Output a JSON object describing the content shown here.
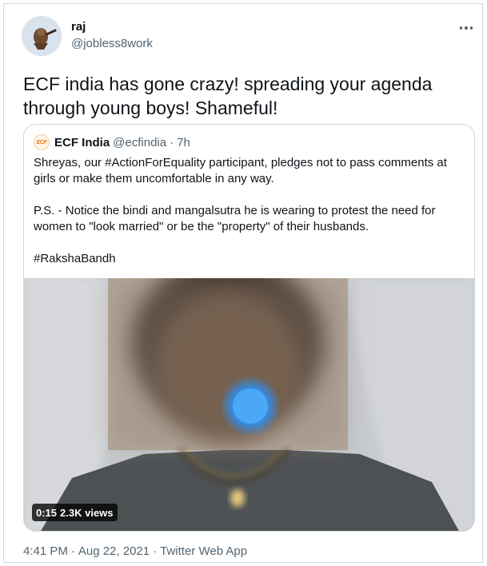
{
  "author": {
    "name": "raj",
    "handle": "@jobless8work"
  },
  "tweet": {
    "text_line1": "ECF india  has gone crazy! spreading your agenda",
    "text_line2": "through young boys! Shameful!"
  },
  "quoted": {
    "logo_text": "ECF",
    "name": "ECF India",
    "handle": "@ecfindia",
    "separator": "·",
    "time": "7h",
    "para1_line1": "Shreyas, our #ActionForEquality participant, pledges not to pass comments at",
    "para1_line2": "girls or make them uncomfortable in any way.",
    "para2_line1": "P.S. - Notice the bindi and mangalsutra he is wearing to protest the need for",
    "para2_line2": "women to \"look married\" or be the \"property\" of their husbands.",
    "hashtag": "#RakshaBandh",
    "video": {
      "duration": "0:15",
      "views": "2.3K views"
    }
  },
  "footer": {
    "time": "4:41 PM",
    "date": "Aug 22, 2021",
    "source": "Twitter Web App",
    "separator": "·"
  },
  "colors": {
    "text": "#0f1419",
    "secondary": "#536471",
    "border": "#cfd9de",
    "blur_dot": "#3b9cf0"
  },
  "icons": [
    "more-horizontal-icon",
    "ecf-logo-icon"
  ]
}
